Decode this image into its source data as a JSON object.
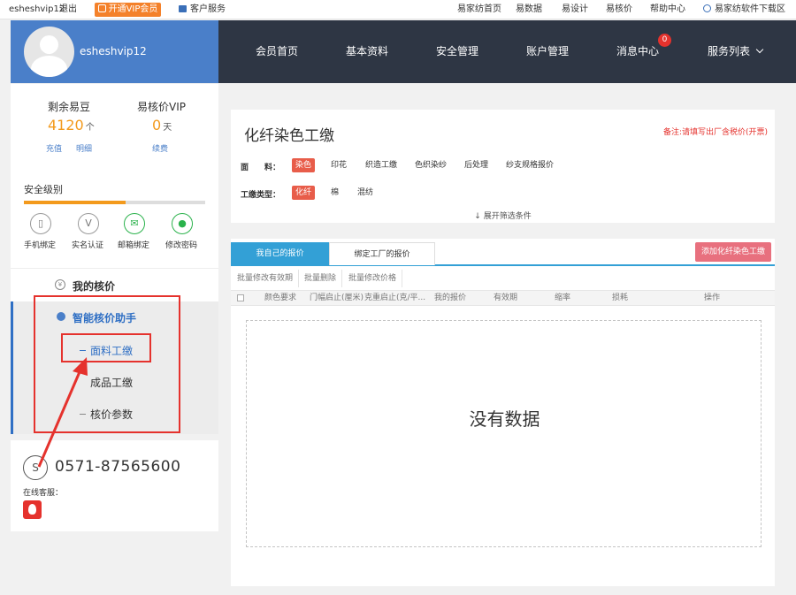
{
  "topbar": {
    "username": "esheshvip12",
    "logout": "退出",
    "vip_button": "开通VIP会员",
    "customer_service": "客户服务",
    "links": [
      "易家纺首页",
      "易数据",
      "易设计",
      "易核价",
      "帮助中心"
    ],
    "download": "易家纺软件下载区"
  },
  "profile": {
    "username": "esheshvip12"
  },
  "nav": {
    "items": [
      "会员首页",
      "基本资料",
      "安全管理",
      "账户管理",
      "消息中心",
      "服务列表"
    ],
    "message_badge": "0"
  },
  "account": {
    "beans_label": "剩余易豆",
    "beans_value": "4120",
    "beans_unit": "个",
    "recharge": "充值",
    "detail": "明细",
    "vip_label": "易核价VIP",
    "vip_value": "0",
    "vip_unit": "天",
    "renew": "续费"
  },
  "security": {
    "label": "安全级别",
    "level_fraction": 0.56,
    "items": [
      "手机绑定",
      "实名认证",
      "邮箱绑定",
      "修改密码"
    ]
  },
  "menu": {
    "my_price": "我的核价",
    "smart_assistant": "智能核价助手",
    "sub_items": [
      "面料工缴",
      "成品工缴",
      "核价参数"
    ]
  },
  "contact": {
    "phone": "0571-87565600",
    "online_service": "在线客服："
  },
  "filter": {
    "title": "化纤染色工缴",
    "note": "备注:请填写出厂含税价(开票)",
    "fabric_label": "面　　料：",
    "fabric_options": [
      "染色",
      "印花",
      "织造工缴",
      "色织染纱",
      "后处理",
      "纱支规格报价"
    ],
    "type_label": "工缴类型：",
    "type_options": [
      "化纤",
      "棉",
      "混纺"
    ],
    "expand": "↓ 展开筛选条件"
  },
  "quotes": {
    "tab_own": "我自己的报价",
    "tab_factory": "绑定工厂的报价",
    "add_button": "添加化纤染色工缴",
    "bulk_actions": [
      "批量修改有效期",
      "批量删除",
      "批量修改价格"
    ],
    "columns": [
      "颜色要求",
      "门幅启止(厘米)",
      "克重启止(克/平...",
      "我的报价",
      "有效期",
      "缩率",
      "损耗",
      "操作"
    ],
    "empty_text": "没有数据"
  },
  "colors": {
    "nav_bg": "#2e3644",
    "profile_bg": "#4a7fc9",
    "accent_orange": "#f39a1d",
    "tab_blue": "#33a0d6",
    "chip_red": "#e85d4a",
    "annotation_red": "#e5322d"
  }
}
